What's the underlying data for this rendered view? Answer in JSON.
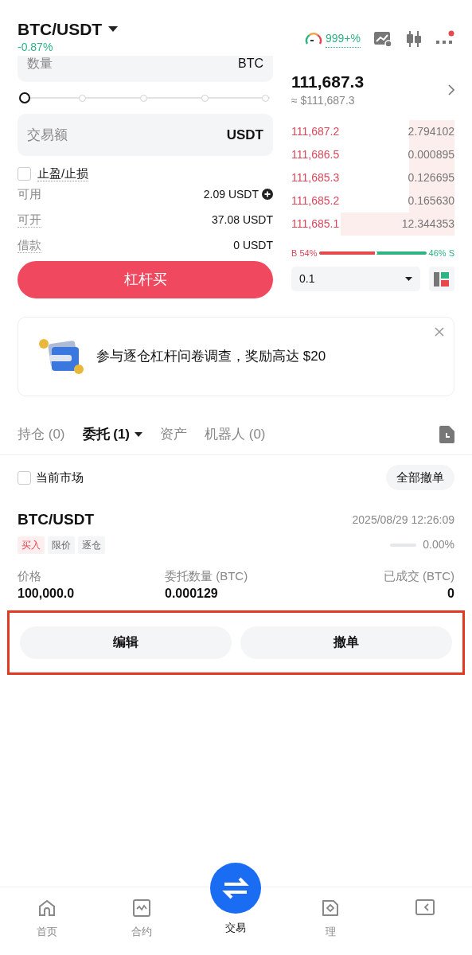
{
  "header": {
    "pair": "BTC/USDT",
    "change": "-0.87%",
    "gauge": "999+%",
    "has_notification": true
  },
  "order_form": {
    "quantity": {
      "placeholder": "数量",
      "unit": "BTC"
    },
    "slider": {
      "level": 0
    },
    "amount": {
      "placeholder": "交易额",
      "unit": "USDT"
    },
    "tp_sl": {
      "label": "止盈/止损",
      "checked": false
    },
    "info": [
      {
        "label": "可用",
        "value": "2.09 USDT",
        "add": true
      },
      {
        "label": "可开",
        "value": "37.08 USDT"
      },
      {
        "label": "借款",
        "value": "0 USDT"
      }
    ],
    "submit": "杠杆买"
  },
  "ticker": {
    "price": "111,687.3",
    "fiat": "≈ $111,687.3"
  },
  "order_book": {
    "asks": [
      {
        "price": "111,687.2",
        "amount": "2.794102",
        "level": 0.28
      },
      {
        "price": "111,686.5",
        "amount": "0.000895",
        "level": 0.28
      },
      {
        "price": "111,685.3",
        "amount": "0.126695",
        "level": 0.28
      },
      {
        "price": "111,685.2",
        "amount": "0.165630",
        "level": 0.28
      },
      {
        "price": "111,685.1",
        "amount": "12.344353",
        "level": 0.7
      }
    ],
    "buy_label": "B 54%",
    "sell_label": "46% S",
    "buy_share": {
      "level": 0.54
    },
    "precision": "0.1"
  },
  "banner": {
    "text": "参与逐仓杠杆问卷调查，奖励高达 $20"
  },
  "tabs": [
    {
      "label": "持仓 (0)",
      "selected": false
    },
    {
      "label": "委托 (1)",
      "selected": true,
      "dropdown": true
    },
    {
      "label": "资产",
      "selected": false
    },
    {
      "label": "机器人 (0)",
      "selected": false
    }
  ],
  "filter": {
    "label": "当前市场",
    "checked": false
  },
  "cancel_all": "全部撤单",
  "order": {
    "pair": "BTC/USDT",
    "time": "2025/08/29 12:26:09",
    "tags": [
      {
        "label": "买入",
        "kind": "side"
      },
      {
        "label": "限价",
        "kind": "plain"
      },
      {
        "label": "逐仓",
        "kind": "plain"
      }
    ],
    "progress": {
      "level": 0
    },
    "progress_text": "0.00%",
    "fields": [
      {
        "label": "价格",
        "value": "100,000.0"
      },
      {
        "label": "委托数量 (BTC)",
        "value": "0.000129"
      },
      {
        "label": "已成交 (BTC)",
        "value": "0"
      }
    ],
    "actions": [
      "编辑",
      "撤单"
    ],
    "highlighted": true
  },
  "nav": [
    {
      "label": "首页",
      "kind": "home",
      "selected": false
    },
    {
      "label": "合约",
      "kind": "chart",
      "selected": false
    },
    {
      "label": "交易",
      "kind": "trade",
      "selected": true
    },
    {
      "label": "理",
      "kind": "finance",
      "selected": false
    },
    {
      "kind": "wallet",
      "selected": false
    }
  ]
}
